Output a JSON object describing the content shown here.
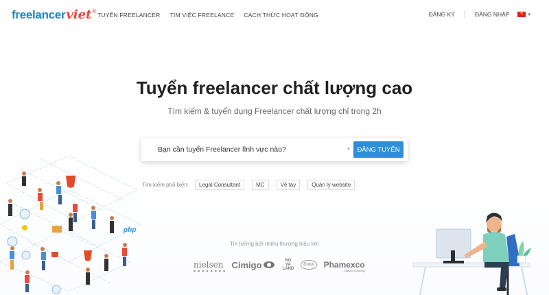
{
  "brand": {
    "logo_main": "freelancer",
    "logo_accent": "viet",
    "logo_mark": "®"
  },
  "nav": {
    "items": [
      {
        "label": "TUYỂN FREELANCER"
      },
      {
        "label": "TÌM VIỆC FREELANCE"
      },
      {
        "label": "CÁCH THỨC HOẠT ĐỘNG"
      }
    ]
  },
  "auth": {
    "register": "ĐĂNG KÝ",
    "login": "ĐĂNG NHẬP",
    "language_icon": "vietnam-flag-icon"
  },
  "hero": {
    "title": "Tuyển freelancer chất lượng cao",
    "subtitle": "Tìm kiếm & tuyển dụng Freelancer chất lượng chỉ trong 2h"
  },
  "search": {
    "placeholder": "Bạn cần tuyển Freelancer lĩnh vực nào?",
    "button": "ĐĂNG TUYỂN"
  },
  "popular": {
    "label": "Tìm kiếm phổ biến:",
    "tags": [
      "Legal Consultant",
      "MC",
      "Vẽ tay",
      "Quản lý website"
    ]
  },
  "trusted": {
    "label": "Tin tưởng bởi nhiều thương hiệu lớn",
    "brands": [
      "nielsen",
      "Cimigo",
      "NOVA LAND",
      "Dulux",
      "Phamexco"
    ]
  },
  "colors": {
    "primary": "#2e8fd8",
    "logo_blue": "#1e88c8",
    "logo_red": "#e8453c"
  },
  "illustration": {
    "php_label": "php"
  }
}
